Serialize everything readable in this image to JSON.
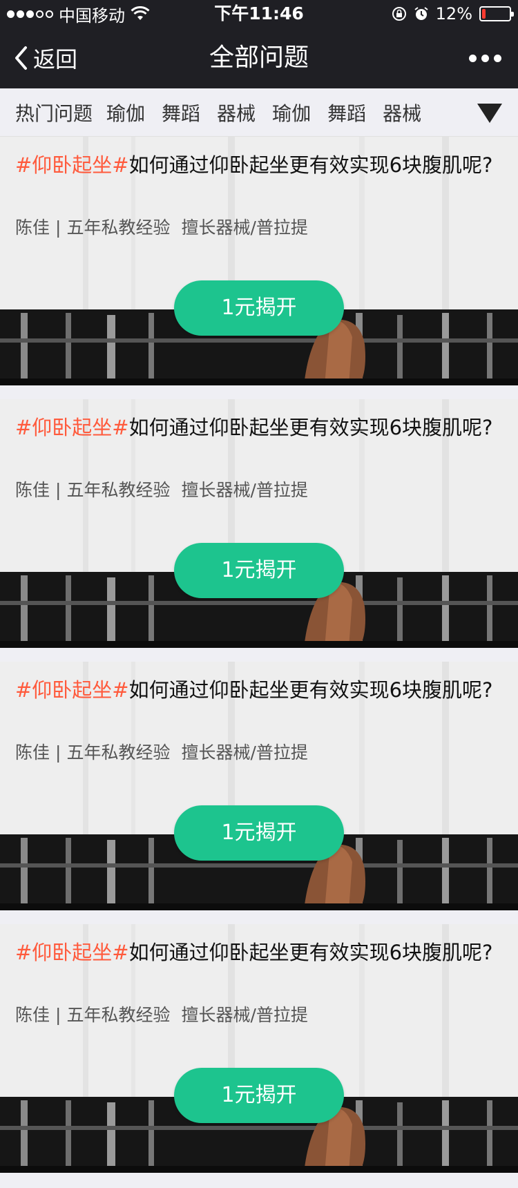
{
  "status_bar": {
    "carrier": "中国移动",
    "signal_bars_filled": 3,
    "signal_bars_total": 5,
    "time": "下午11:46",
    "battery_percent": "12%",
    "battery_level": 0.12,
    "battery_color": "#ff3b30"
  },
  "nav": {
    "back_label": "返回",
    "title": "全部问题"
  },
  "tabs": {
    "items": [
      "热门问题",
      "瑜伽",
      "舞蹈",
      "器械",
      "瑜伽",
      "舞蹈",
      "器械"
    ]
  },
  "cards": [
    {
      "tag": "#仰卧起坐#",
      "question": "如何通过仰卧起坐更有效实现6块腹肌呢?",
      "author": "陈佳",
      "sep": "|",
      "experience": "五年私教经验",
      "specialty": "擅长器械/普拉提",
      "button": "1元揭开"
    },
    {
      "tag": "#仰卧起坐#",
      "question": "如何通过仰卧起坐更有效实现6块腹肌呢?",
      "author": "陈佳",
      "sep": "|",
      "experience": "五年私教经验",
      "specialty": "擅长器械/普拉提",
      "button": "1元揭开"
    },
    {
      "tag": "#仰卧起坐#",
      "question": "如何通过仰卧起坐更有效实现6块腹肌呢?",
      "author": "陈佳",
      "sep": "|",
      "experience": "五年私教经验",
      "specialty": "擅长器械/普拉提",
      "button": "1元揭开"
    },
    {
      "tag": "#仰卧起坐#",
      "question": "如何通过仰卧起坐更有效实现6块腹肌呢?",
      "author": "陈佳",
      "sep": "|",
      "experience": "五年私教经验",
      "specialty": "擅长器械/普拉提",
      "button": "1元揭开"
    }
  ],
  "colors": {
    "bar_bg": "#1f1f24",
    "accent_green": "#1dc48e",
    "tag_red": "#ff5a3c"
  }
}
